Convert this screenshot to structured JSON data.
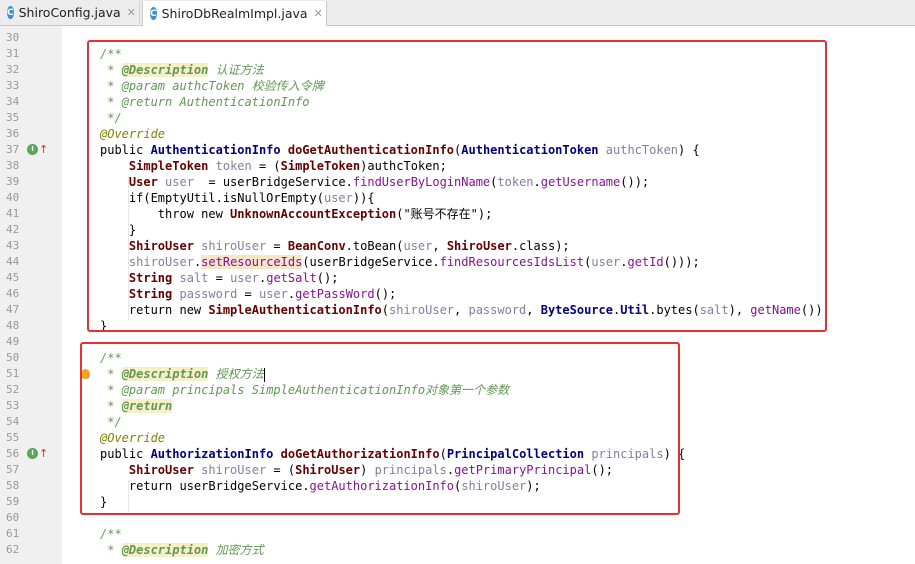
{
  "tabs": [
    {
      "label": "ShiroConfig.java",
      "icon": "java-class-icon",
      "active": false
    },
    {
      "label": "ShiroDbRealmImpl.java",
      "icon": "java-class-icon",
      "active": true
    }
  ],
  "tab_close": "✕",
  "lines": [
    {
      "n": "30",
      "segs": []
    },
    {
      "n": "31",
      "segs": [
        {
          "t": "/**",
          "c": "com"
        }
      ]
    },
    {
      "n": "32",
      "segs": [
        {
          "t": " * ",
          "c": "com"
        },
        {
          "t": "@Description",
          "c": "tag"
        },
        {
          "t": " 认证方法",
          "c": "com"
        }
      ]
    },
    {
      "n": "33",
      "segs": [
        {
          "t": " * ",
          "c": "com"
        },
        {
          "t": "@param",
          "c": "com"
        },
        {
          "t": " authcToken",
          "c": "par"
        },
        {
          "t": " 校验传入令牌",
          "c": "com"
        }
      ]
    },
    {
      "n": "34",
      "segs": [
        {
          "t": " * ",
          "c": "com"
        },
        {
          "t": "@return",
          "c": "com"
        },
        {
          "t": " AuthenticationInfo",
          "c": "par"
        }
      ]
    },
    {
      "n": "35",
      "segs": [
        {
          "t": " */",
          "c": "com"
        }
      ]
    },
    {
      "n": "36",
      "segs": [
        {
          "t": "@Override",
          "c": "ann"
        }
      ]
    },
    {
      "n": "37",
      "gutter": "impl",
      "segs": [
        {
          "t": "public ",
          "c": "def"
        },
        {
          "t": "AuthenticationInfo",
          "c": "type"
        },
        {
          "t": " ",
          "c": "def"
        },
        {
          "t": "doGetAuthenticationInfo",
          "c": "cls"
        },
        {
          "t": "(",
          "c": "def"
        },
        {
          "t": "AuthenticationToken",
          "c": "type"
        },
        {
          "t": " authcToken",
          "c": "var"
        },
        {
          "t": ") {",
          "c": "def"
        }
      ]
    },
    {
      "n": "38",
      "segs": [
        {
          "t": "    ",
          "c": "def"
        },
        {
          "t": "SimpleToken",
          "c": "cls"
        },
        {
          "t": " token",
          "c": "var"
        },
        {
          "t": " = (",
          "c": "def"
        },
        {
          "t": "SimpleToken",
          "c": "cls"
        },
        {
          "t": ")authcToken;",
          "c": "def"
        }
      ]
    },
    {
      "n": "39",
      "segs": [
        {
          "t": "    ",
          "c": "def"
        },
        {
          "t": "User",
          "c": "cls"
        },
        {
          "t": " user",
          "c": "var"
        },
        {
          "t": "  = userBridgeService.",
          "c": "def"
        },
        {
          "t": "findUserByLoginName",
          "c": "mth"
        },
        {
          "t": "(",
          "c": "def"
        },
        {
          "t": "token",
          "c": "var"
        },
        {
          "t": ".",
          "c": "def"
        },
        {
          "t": "getUsername",
          "c": "mth"
        },
        {
          "t": "());",
          "c": "def"
        }
      ]
    },
    {
      "n": "40",
      "segs": [
        {
          "t": "    if(",
          "c": "def"
        },
        {
          "t": "EmptyUtil",
          "c": "def"
        },
        {
          "t": ".isNullOrEmpty(",
          "c": "def"
        },
        {
          "t": "user",
          "c": "var"
        },
        {
          "t": ")){",
          "c": "def"
        }
      ]
    },
    {
      "n": "41",
      "segs": [
        {
          "t": "        throw new ",
          "c": "def"
        },
        {
          "t": "UnknownAccountException",
          "c": "cls"
        },
        {
          "t": "(\"账号不存在\");",
          "c": "def"
        }
      ]
    },
    {
      "n": "42",
      "segs": [
        {
          "t": "    }",
          "c": "def"
        }
      ]
    },
    {
      "n": "43",
      "segs": [
        {
          "t": "    ",
          "c": "def"
        },
        {
          "t": "ShiroUser",
          "c": "cls"
        },
        {
          "t": " shiroUser",
          "c": "var"
        },
        {
          "t": " = ",
          "c": "def"
        },
        {
          "t": "BeanConv",
          "c": "cls"
        },
        {
          "t": ".toBean(",
          "c": "def"
        },
        {
          "t": "user",
          "c": "var"
        },
        {
          "t": ", ",
          "c": "def"
        },
        {
          "t": "ShiroUser",
          "c": "cls"
        },
        {
          "t": ".class);",
          "c": "def"
        }
      ]
    },
    {
      "n": "44",
      "segs": [
        {
          "t": "    ",
          "c": "def"
        },
        {
          "t": "shiroUser",
          "c": "var"
        },
        {
          "t": ".",
          "c": "def"
        },
        {
          "t": "setResourceIds",
          "c": "mthhl"
        },
        {
          "t": "(userBridgeService.",
          "c": "def"
        },
        {
          "t": "findResourcesIdsList",
          "c": "mth"
        },
        {
          "t": "(",
          "c": "def"
        },
        {
          "t": "user",
          "c": "var"
        },
        {
          "t": ".",
          "c": "def"
        },
        {
          "t": "getId",
          "c": "mth"
        },
        {
          "t": "()));",
          "c": "def"
        }
      ]
    },
    {
      "n": "45",
      "segs": [
        {
          "t": "    ",
          "c": "def"
        },
        {
          "t": "String",
          "c": "cls"
        },
        {
          "t": " salt",
          "c": "var"
        },
        {
          "t": " = ",
          "c": "def"
        },
        {
          "t": "user",
          "c": "var"
        },
        {
          "t": ".",
          "c": "def"
        },
        {
          "t": "getSalt",
          "c": "mth"
        },
        {
          "t": "();",
          "c": "def"
        }
      ]
    },
    {
      "n": "46",
      "segs": [
        {
          "t": "    ",
          "c": "def"
        },
        {
          "t": "String",
          "c": "cls"
        },
        {
          "t": " password",
          "c": "var"
        },
        {
          "t": " = ",
          "c": "def"
        },
        {
          "t": "user",
          "c": "var"
        },
        {
          "t": ".",
          "c": "def"
        },
        {
          "t": "getPassWord",
          "c": "mth"
        },
        {
          "t": "();",
          "c": "def"
        }
      ]
    },
    {
      "n": "47",
      "segs": [
        {
          "t": "    return new ",
          "c": "def"
        },
        {
          "t": "SimpleAuthenticationInfo",
          "c": "cls"
        },
        {
          "t": "(",
          "c": "def"
        },
        {
          "t": "shiroUser",
          "c": "var"
        },
        {
          "t": ", ",
          "c": "def"
        },
        {
          "t": "password",
          "c": "var"
        },
        {
          "t": ", ",
          "c": "def"
        },
        {
          "t": "ByteSource",
          "c": "type"
        },
        {
          "t": ".",
          "c": "def"
        },
        {
          "t": "Util",
          "c": "type"
        },
        {
          "t": ".bytes(",
          "c": "def"
        },
        {
          "t": "salt",
          "c": "var"
        },
        {
          "t": "), ",
          "c": "def"
        },
        {
          "t": "getName",
          "c": "mth"
        },
        {
          "t": "());",
          "c": "def"
        }
      ]
    },
    {
      "n": "48",
      "segs": [
        {
          "t": "}",
          "c": "def"
        }
      ]
    },
    {
      "n": "49",
      "segs": []
    },
    {
      "n": "50",
      "segs": [
        {
          "t": "/**",
          "c": "com"
        }
      ]
    },
    {
      "n": "51",
      "gutter": "bulb",
      "cursor": true,
      "segs": [
        {
          "t": " * ",
          "c": "com"
        },
        {
          "t": "@Description",
          "c": "tag"
        },
        {
          "t": " 授权方法",
          "c": "com"
        }
      ]
    },
    {
      "n": "52",
      "segs": [
        {
          "t": " * ",
          "c": "com"
        },
        {
          "t": "@param",
          "c": "com"
        },
        {
          "t": " principals",
          "c": "par"
        },
        {
          "t": " SimpleAuthenticationInfo对象第一个参数",
          "c": "com"
        }
      ]
    },
    {
      "n": "53",
      "segs": [
        {
          "t": " * ",
          "c": "com"
        },
        {
          "t": "@return",
          "c": "tag"
        }
      ]
    },
    {
      "n": "54",
      "segs": [
        {
          "t": " */",
          "c": "com"
        }
      ]
    },
    {
      "n": "55",
      "segs": [
        {
          "t": "@Override",
          "c": "ann"
        }
      ]
    },
    {
      "n": "56",
      "gutter": "impl",
      "segs": [
        {
          "t": "public ",
          "c": "def"
        },
        {
          "t": "AuthorizationInfo",
          "c": "type"
        },
        {
          "t": " ",
          "c": "def"
        },
        {
          "t": "doGetAuthorizationInfo",
          "c": "cls"
        },
        {
          "t": "(",
          "c": "def"
        },
        {
          "t": "PrincipalCollection",
          "c": "type"
        },
        {
          "t": " principals",
          "c": "var"
        },
        {
          "t": ") {",
          "c": "def"
        }
      ]
    },
    {
      "n": "57",
      "segs": [
        {
          "t": "    ",
          "c": "def"
        },
        {
          "t": "ShiroUser",
          "c": "cls"
        },
        {
          "t": " shiroUser",
          "c": "var"
        },
        {
          "t": " = (",
          "c": "def"
        },
        {
          "t": "ShiroUser",
          "c": "cls"
        },
        {
          "t": ") ",
          "c": "def"
        },
        {
          "t": "principals",
          "c": "var"
        },
        {
          "t": ".",
          "c": "def"
        },
        {
          "t": "getPrimaryPrincipal",
          "c": "mth"
        },
        {
          "t": "();",
          "c": "def"
        }
      ]
    },
    {
      "n": "58",
      "segs": [
        {
          "t": "    return userBridgeService.",
          "c": "def"
        },
        {
          "t": "getAuthorizationInfo",
          "c": "mth"
        },
        {
          "t": "(",
          "c": "def"
        },
        {
          "t": "shiroUser",
          "c": "var"
        },
        {
          "t": ");",
          "c": "def"
        }
      ]
    },
    {
      "n": "59",
      "segs": [
        {
          "t": "}",
          "c": "def"
        }
      ]
    },
    {
      "n": "60",
      "segs": []
    },
    {
      "n": "61",
      "segs": [
        {
          "t": "/**",
          "c": "com"
        }
      ]
    },
    {
      "n": "62",
      "segs": [
        {
          "t": " * ",
          "c": "com"
        },
        {
          "t": "@Description",
          "c": "tag"
        },
        {
          "t": " 加密方式",
          "c": "com"
        }
      ]
    }
  ],
  "colors": {
    "highlight_box": "#e8312f",
    "comment": "#629755",
    "keyword": "#000080"
  }
}
